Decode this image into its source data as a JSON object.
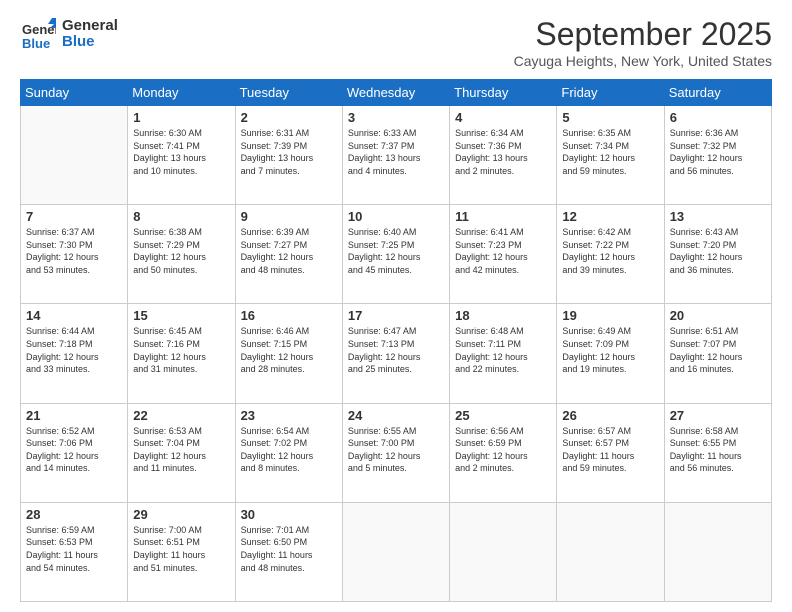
{
  "logo": {
    "line1": "General",
    "line2": "Blue"
  },
  "header": {
    "month": "September 2025",
    "location": "Cayuga Heights, New York, United States"
  },
  "weekdays": [
    "Sunday",
    "Monday",
    "Tuesday",
    "Wednesday",
    "Thursday",
    "Friday",
    "Saturday"
  ],
  "weeks": [
    [
      {
        "day": "",
        "content": ""
      },
      {
        "day": "1",
        "content": "Sunrise: 6:30 AM\nSunset: 7:41 PM\nDaylight: 13 hours\nand 10 minutes."
      },
      {
        "day": "2",
        "content": "Sunrise: 6:31 AM\nSunset: 7:39 PM\nDaylight: 13 hours\nand 7 minutes."
      },
      {
        "day": "3",
        "content": "Sunrise: 6:33 AM\nSunset: 7:37 PM\nDaylight: 13 hours\nand 4 minutes."
      },
      {
        "day": "4",
        "content": "Sunrise: 6:34 AM\nSunset: 7:36 PM\nDaylight: 13 hours\nand 2 minutes."
      },
      {
        "day": "5",
        "content": "Sunrise: 6:35 AM\nSunset: 7:34 PM\nDaylight: 12 hours\nand 59 minutes."
      },
      {
        "day": "6",
        "content": "Sunrise: 6:36 AM\nSunset: 7:32 PM\nDaylight: 12 hours\nand 56 minutes."
      }
    ],
    [
      {
        "day": "7",
        "content": "Sunrise: 6:37 AM\nSunset: 7:30 PM\nDaylight: 12 hours\nand 53 minutes."
      },
      {
        "day": "8",
        "content": "Sunrise: 6:38 AM\nSunset: 7:29 PM\nDaylight: 12 hours\nand 50 minutes."
      },
      {
        "day": "9",
        "content": "Sunrise: 6:39 AM\nSunset: 7:27 PM\nDaylight: 12 hours\nand 48 minutes."
      },
      {
        "day": "10",
        "content": "Sunrise: 6:40 AM\nSunset: 7:25 PM\nDaylight: 12 hours\nand 45 minutes."
      },
      {
        "day": "11",
        "content": "Sunrise: 6:41 AM\nSunset: 7:23 PM\nDaylight: 12 hours\nand 42 minutes."
      },
      {
        "day": "12",
        "content": "Sunrise: 6:42 AM\nSunset: 7:22 PM\nDaylight: 12 hours\nand 39 minutes."
      },
      {
        "day": "13",
        "content": "Sunrise: 6:43 AM\nSunset: 7:20 PM\nDaylight: 12 hours\nand 36 minutes."
      }
    ],
    [
      {
        "day": "14",
        "content": "Sunrise: 6:44 AM\nSunset: 7:18 PM\nDaylight: 12 hours\nand 33 minutes."
      },
      {
        "day": "15",
        "content": "Sunrise: 6:45 AM\nSunset: 7:16 PM\nDaylight: 12 hours\nand 31 minutes."
      },
      {
        "day": "16",
        "content": "Sunrise: 6:46 AM\nSunset: 7:15 PM\nDaylight: 12 hours\nand 28 minutes."
      },
      {
        "day": "17",
        "content": "Sunrise: 6:47 AM\nSunset: 7:13 PM\nDaylight: 12 hours\nand 25 minutes."
      },
      {
        "day": "18",
        "content": "Sunrise: 6:48 AM\nSunset: 7:11 PM\nDaylight: 12 hours\nand 22 minutes."
      },
      {
        "day": "19",
        "content": "Sunrise: 6:49 AM\nSunset: 7:09 PM\nDaylight: 12 hours\nand 19 minutes."
      },
      {
        "day": "20",
        "content": "Sunrise: 6:51 AM\nSunset: 7:07 PM\nDaylight: 12 hours\nand 16 minutes."
      }
    ],
    [
      {
        "day": "21",
        "content": "Sunrise: 6:52 AM\nSunset: 7:06 PM\nDaylight: 12 hours\nand 14 minutes."
      },
      {
        "day": "22",
        "content": "Sunrise: 6:53 AM\nSunset: 7:04 PM\nDaylight: 12 hours\nand 11 minutes."
      },
      {
        "day": "23",
        "content": "Sunrise: 6:54 AM\nSunset: 7:02 PM\nDaylight: 12 hours\nand 8 minutes."
      },
      {
        "day": "24",
        "content": "Sunrise: 6:55 AM\nSunset: 7:00 PM\nDaylight: 12 hours\nand 5 minutes."
      },
      {
        "day": "25",
        "content": "Sunrise: 6:56 AM\nSunset: 6:59 PM\nDaylight: 12 hours\nand 2 minutes."
      },
      {
        "day": "26",
        "content": "Sunrise: 6:57 AM\nSunset: 6:57 PM\nDaylight: 11 hours\nand 59 minutes."
      },
      {
        "day": "27",
        "content": "Sunrise: 6:58 AM\nSunset: 6:55 PM\nDaylight: 11 hours\nand 56 minutes."
      }
    ],
    [
      {
        "day": "28",
        "content": "Sunrise: 6:59 AM\nSunset: 6:53 PM\nDaylight: 11 hours\nand 54 minutes."
      },
      {
        "day": "29",
        "content": "Sunrise: 7:00 AM\nSunset: 6:51 PM\nDaylight: 11 hours\nand 51 minutes."
      },
      {
        "day": "30",
        "content": "Sunrise: 7:01 AM\nSunset: 6:50 PM\nDaylight: 11 hours\nand 48 minutes."
      },
      {
        "day": "",
        "content": ""
      },
      {
        "day": "",
        "content": ""
      },
      {
        "day": "",
        "content": ""
      },
      {
        "day": "",
        "content": ""
      }
    ]
  ]
}
